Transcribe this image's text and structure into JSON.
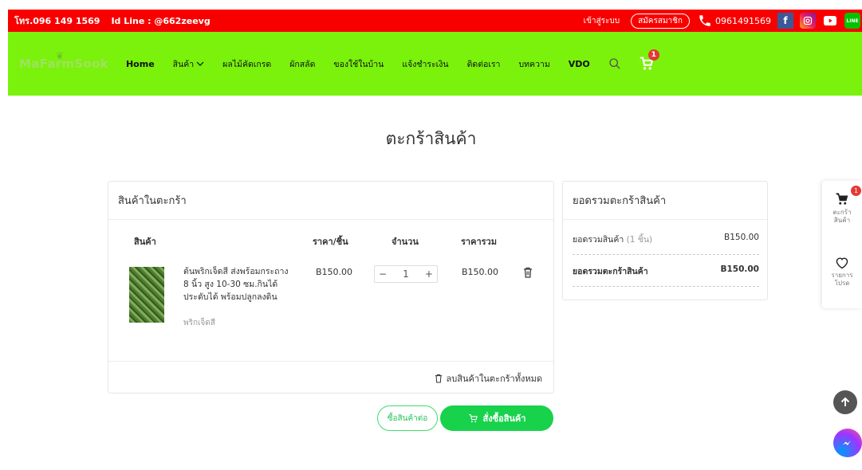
{
  "topbar": {
    "contact": "โทร.096 149 1569",
    "line_id": "Id Line : @662zeevg",
    "login": "เข้าสู่ระบบ",
    "register": "สมัครสมาชิก",
    "phone": "0961491569"
  },
  "nav": {
    "logo": "MaFarmSook",
    "items": [
      "Home",
      "สินค้า",
      "ผลไม้คัดเกรด",
      "ผักสลัด",
      "ของใช้ในบ้าน",
      "แจ้งชำระเงิน",
      "ติดต่อเรา",
      "บทความ",
      "VDO"
    ],
    "cart_count": "1"
  },
  "page_title": "ตะกร้าสินค้า",
  "cart": {
    "heading": "สินค้าในตะกร้า",
    "columns": {
      "product": "สินค้า",
      "unit_price": "ราคา/ชิ้น",
      "quantity": "จำนวน",
      "total": "ราคารวม"
    },
    "item": {
      "name_line1": "ต้นพริกเจ็ดสี ส่งพร้อมกระถาง",
      "name_line2": "8 นิ้ว สูง 10-30 ซม.กินได้",
      "name_line3": "ประดับได้ พร้อมปลูกลงดิน",
      "category": "พริกเจ็ดสี",
      "unit_price": "B150.00",
      "quantity": "1",
      "total": "B150.00"
    },
    "clear_all": "ลบสินค้าในตะกร้าทั้งหมด"
  },
  "summary": {
    "heading": "ยอดรวมตะกร้าสินค้า",
    "subtotal_label": "ยอดรวมสินค้า",
    "subtotal_count": "(1 ชิ้น)",
    "subtotal_value": "B150.00",
    "total_label": "ยอดรวมตะกร้าสินค้า",
    "total_value": "B150.00"
  },
  "buttons": {
    "continue": "ซื้อสินค้าต่อ",
    "order": "สั่งซื้อสินค้า"
  },
  "side_panel": {
    "cart_label_1": "ตะกร้า",
    "cart_label_2": "สินค้า",
    "cart_badge": "1",
    "wishlist_label_1": "รายการ",
    "wishlist_label_2": "โปรด"
  },
  "colors": {
    "topbar": "#f90000",
    "nav": "#7af20c",
    "accent_green": "#18d24c"
  }
}
